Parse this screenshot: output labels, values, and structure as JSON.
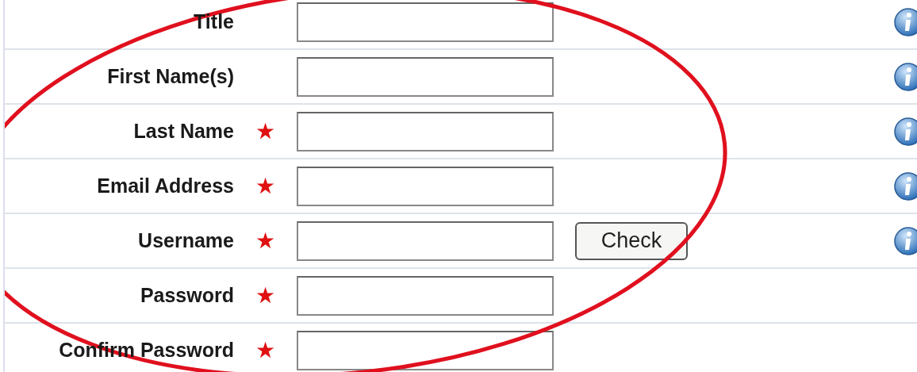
{
  "form": {
    "rows": [
      {
        "label": "Title",
        "required": false,
        "info": true
      },
      {
        "label": "First Name(s)",
        "required": false,
        "info": true
      },
      {
        "label": "Last Name",
        "required": true,
        "info": true
      },
      {
        "label": "Email Address",
        "required": true,
        "info": true
      },
      {
        "label": "Username",
        "required": true,
        "info": true,
        "button": "Check"
      },
      {
        "label": "Password",
        "required": true,
        "info": false
      },
      {
        "label": "Confirm Password",
        "required": true,
        "info": false
      }
    ]
  },
  "required_mark": "★",
  "annotation": {
    "kind": "ellipse",
    "color": "#e0101e"
  }
}
